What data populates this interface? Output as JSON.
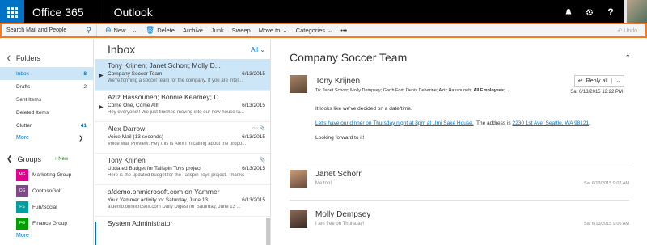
{
  "header": {
    "brand": "Office 365",
    "app": "Outlook",
    "icons": [
      "bell-icon",
      "gear-icon",
      "help-icon"
    ],
    "help_label": "?"
  },
  "commands": {
    "search_placeholder": "Search Mail and People",
    "new_label": "New",
    "delete_label": "Delete",
    "archive_label": "Archive",
    "junk_label": "Junk",
    "sweep_label": "Sweep",
    "moveto_label": "Move to",
    "categories_label": "Categories",
    "more_label": "•••",
    "undo_label": "Undo"
  },
  "folders": {
    "title": "Folders",
    "items": [
      {
        "label": "Inbox",
        "count": "8"
      },
      {
        "label": "Drafts",
        "count": "2"
      },
      {
        "label": "Sent Items",
        "count": ""
      },
      {
        "label": "Deleted Items",
        "count": ""
      },
      {
        "label": "Clutter",
        "count": "41"
      }
    ],
    "more": "More"
  },
  "groups": {
    "title": "Groups",
    "new_label": "New",
    "items": [
      {
        "badge": "MG",
        "label": "Marketing Group",
        "color": "#e3008c"
      },
      {
        "badge": "CG",
        "label": "ContosoGolf",
        "color": "#7e4a88"
      },
      {
        "badge": "FS",
        "label": "Fun/Social",
        "color": "#00a0a0"
      },
      {
        "badge": "FG",
        "label": "Finance Group",
        "color": "#00a000"
      }
    ],
    "more": "More"
  },
  "inbox": {
    "title": "Inbox",
    "filter": "All",
    "messages": [
      {
        "from": "Tony Krijnen; Janet Schorr; Molly D...",
        "subject": "Company Soccer Team",
        "date": "6/13/2015",
        "preview": "We're forming a soccer team for the company. If you are inter..."
      },
      {
        "from": "Aziz Hassouneh; Bonnie Kearney; D...",
        "subject": "Come One, Come All!",
        "date": "6/13/2015",
        "preview": "Hey everyone!! We just finished moving into our new house la..."
      },
      {
        "from": "Alex Darrow",
        "subject": "Voice Mail (13 seconds)",
        "date": "6/13/2015",
        "preview": "Voice Mail Preview: Hey this is Alex I'm calling about the propo..."
      },
      {
        "from": "Tony Krijnen",
        "subject": "Updated Budget for Tailspin Toys project",
        "date": "6/13/2015",
        "preview": "Here is the updated budget for the Tailspin Toys project. Thanks"
      },
      {
        "from": "afdemo.onmicrosoft.com on Yammer",
        "subject": "Your Yammer activity for Saturday, June 13",
        "date": "6/13/2015",
        "preview": "afdemo.onmicrosoft.com Daily Digest for Saturday, June 13 ..."
      },
      {
        "from": "System Administrator",
        "subject": "",
        "date": "",
        "preview": ""
      }
    ]
  },
  "conversation": {
    "title": "Company Soccer Team",
    "sender": "Tony Krijnen",
    "to_prefix": "To:",
    "to": "Janet Schorr; Molly Dempsey; Garth Fort; Denis Deherine; Aziz Hassouneh;",
    "to_bold": "All Employees;",
    "reply_label": "Reply all",
    "date": "Sat 6/13/2015 12:22 PM",
    "line1": "It looks like we've decided on a date/time.",
    "link1": "Let's have our dinner on Thursday night at 8pm at Umi Sake House.",
    "mid": "The address is",
    "link2": "2230 1st Ave, Seattle, WA 98121",
    "line3": "Looking forward to it!",
    "replies": [
      {
        "name": "Janet Schorr",
        "snippet": "Me too!",
        "date": "Sat 6/13/2015 9:07 AM"
      },
      {
        "name": "Molly Dempsey",
        "snippet": "I am free on Thursday!",
        "date": "Sat 6/13/2015 9:06 AM"
      }
    ]
  }
}
